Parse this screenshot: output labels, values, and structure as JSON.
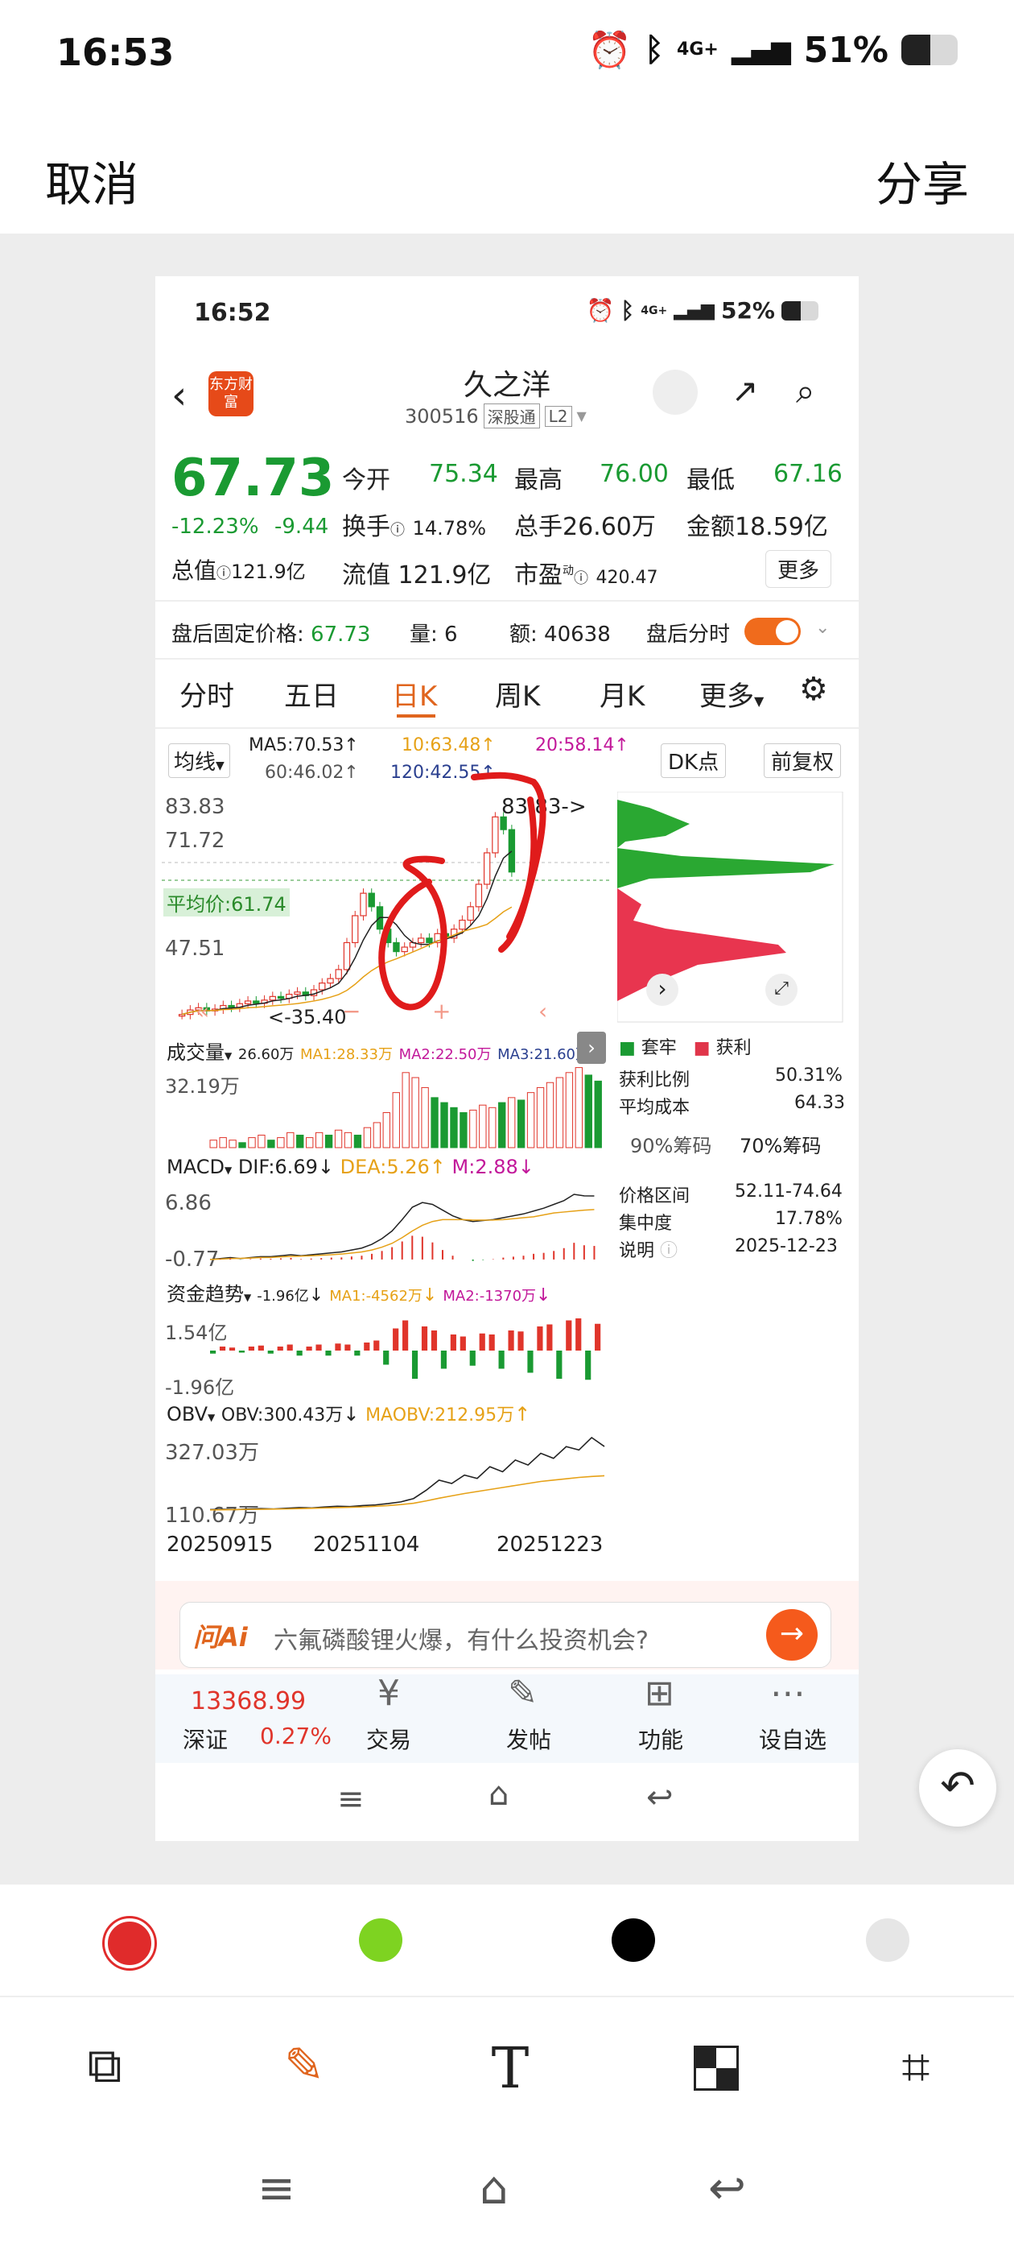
{
  "status_bar": {
    "time": "16:53",
    "network": "4G+",
    "battery_percent": "51%",
    "battery_level": 0.51
  },
  "editor": {
    "cancel_label": "取消",
    "share_label": "分享"
  },
  "colors": {
    "accent": "#e0651e",
    "up": "#e0352b",
    "down": "#1a9a32",
    "palette": [
      "#e02b2b",
      "#7ed321",
      "#000000",
      "#e6e6e6"
    ]
  },
  "inner_status": {
    "time": "16:52",
    "network": "4G+",
    "battery_percent": "52%"
  },
  "stock": {
    "name": "久之洋",
    "code": "300516",
    "badge": "深股通",
    "level": "L2",
    "logo": "东方财富",
    "price": "67.73",
    "change_pct": "-12.23%",
    "change": "-9.44",
    "open_label": "今开",
    "open": "75.34",
    "high_label": "最高",
    "high": "76.00",
    "low_label": "最低",
    "low": "67.16",
    "turnover_label": "换手",
    "turnover": "14.78%",
    "volume_label": "总手",
    "volume": "26.60万",
    "amount_label": "金额",
    "amount": "18.59亿",
    "mcap_label": "总值",
    "mcap": "121.9亿",
    "float_label": "流值",
    "float": "121.9亿",
    "pe_label": "市盈",
    "pe_sup": "动",
    "pe": "420.47",
    "more_label": "更多"
  },
  "afterhours": {
    "price_label": "盘后固定价格:",
    "price": "67.73",
    "qty_label": "量:",
    "qty": "6",
    "amount_label": "额:",
    "amount": "40638",
    "toggle_label": "盘后分时"
  },
  "tabs": [
    "分时",
    "五日",
    "日K",
    "周K",
    "月K",
    "更多"
  ],
  "active_tab": "日K",
  "ma_row": {
    "ma_select": "均线",
    "ma5": "MA5:70.53",
    "ma10": "10:63.48",
    "ma20": "20:58.14",
    "ma60": "60:46.02",
    "ma120": "120:42.55",
    "dk": "DK点",
    "adjust": "前复权"
  },
  "chart_labels": {
    "y1": "83.83",
    "y2": "71.72",
    "y3": "47.51",
    "high_marker": "83.83->",
    "cost_label": "平均价:61.74",
    "low_marker": "<-35.40"
  },
  "volume_panel": {
    "title": "成交量",
    "v": "26.60万",
    "ma1": "MA1:28.33万",
    "ma2": "MA2:22.50万",
    "ma3": "MA3:21.60万",
    "axis": "32.19万"
  },
  "macd_panel": {
    "title": "MACD",
    "dif": "DIF:6.69",
    "dea": "DEA:5.26",
    "m": "M:2.88",
    "axis_top": "6.86",
    "axis_bottom": "-0.77"
  },
  "fund_panel": {
    "title": "资金趋势",
    "v": "-1.96亿",
    "ma1": "MA1:-4562万",
    "ma2": "MA2:-1370万",
    "axis_top": "1.54亿",
    "axis_bottom": "-1.96亿"
  },
  "obv_panel": {
    "title": "OBV",
    "obv": "OBV:300.43万",
    "maobv": "MAOBV:212.95万",
    "axis_top": "327.03万",
    "axis_bottom": "110.67万"
  },
  "dates": [
    "20250915",
    "20251104",
    "20251223"
  ],
  "chip": {
    "legend_trapped": "套牢",
    "legend_profit": "获利",
    "profit_ratio_label": "获利比例",
    "profit_ratio": "50.31%",
    "avg_cost_label": "平均成本",
    "avg_cost": "64.33",
    "chip90": "90%筹码",
    "chip70": "70%筹码",
    "range_label": "价格区间",
    "range": "52.11-74.64",
    "concentration_label": "集中度",
    "concentration": "17.78%",
    "note_label": "说明",
    "date": "2025-12-23"
  },
  "ai_bar": {
    "brand": "问Ai",
    "prompt": "六氟磷酸锂火爆，有什么投资机会?"
  },
  "bottom_nav": {
    "index_value": "13368.99",
    "index_name": "深证",
    "index_change": "0.27%",
    "items": [
      "交易",
      "发帖",
      "功能",
      "设自选"
    ]
  },
  "chart_data": [
    {
      "type": "candlestick",
      "title": "",
      "x": [
        "20250915",
        "20251104",
        "20251223"
      ],
      "ylim": [
        35.4,
        83.83
      ],
      "y_ticks": [
        "83.83",
        "71.72",
        "47.51"
      ],
      "series": [
        {
          "values": [
            36,
            37,
            37.5,
            36.8,
            37.2,
            38,
            37.6,
            38.4,
            39,
            38.5,
            39.2,
            40,
            39.6,
            40.5,
            41,
            40.2,
            41.5,
            43,
            44,
            46,
            52,
            58,
            63,
            60,
            55,
            52,
            50,
            51,
            52,
            53,
            52,
            54,
            53,
            55,
            57,
            60,
            65,
            72,
            80,
            77.17,
            67.73
          ]
        }
      ]
    },
    {
      "type": "bar",
      "title": "成交量",
      "ylim": [
        0,
        32.19
      ],
      "series": [
        {
          "values": [
            3,
            4,
            3,
            2,
            4,
            5,
            3,
            4,
            6,
            5,
            4,
            6,
            5,
            7,
            6,
            5,
            8,
            10,
            14,
            22,
            30,
            28,
            24,
            20,
            18,
            16,
            14,
            15,
            17,
            16,
            18,
            20,
            19,
            22,
            24,
            26,
            28,
            30,
            32,
            29,
            26.6
          ]
        }
      ]
    },
    {
      "type": "line",
      "title": "MACD",
      "ylim": [
        -0.77,
        6.86
      ],
      "series": [
        {
          "name": "DIF",
          "values": [
            0,
            0.1,
            0.2,
            0.1,
            0.2,
            0.3,
            0.3,
            0.4,
            0.5,
            0.4,
            0.5,
            0.6,
            0.7,
            0.8,
            1,
            1.2,
            1.6,
            2.2,
            3,
            4.2,
            5.5,
            6,
            5.8,
            5.2,
            4.6,
            4.2,
            4,
            4.1,
            4.2,
            4.4,
            4.6,
            4.8,
            5.1,
            5.4,
            5.8,
            6.2,
            6.86,
            6.7,
            6.69
          ]
        },
        {
          "name": "DEA",
          "values": [
            0,
            0.05,
            0.1,
            0.12,
            0.15,
            0.2,
            0.22,
            0.28,
            0.33,
            0.35,
            0.4,
            0.45,
            0.5,
            0.58,
            0.68,
            0.8,
            1,
            1.3,
            1.7,
            2.3,
            3,
            3.6,
            4,
            4.2,
            4.2,
            4.2,
            4.15,
            4.15,
            4.16,
            4.2,
            4.3,
            4.4,
            4.5,
            4.7,
            4.9,
            5,
            5.1,
            5.2,
            5.26
          ]
        }
      ]
    },
    {
      "type": "line",
      "title": "OBV",
      "ylim": [
        110.67,
        327.03
      ],
      "series": [
        {
          "name": "OBV",
          "values": [
            112,
            113,
            112,
            114,
            115,
            114,
            116,
            118,
            117,
            120,
            122,
            121,
            124,
            126,
            130,
            135,
            145,
            170,
            200,
            190,
            215,
            205,
            240,
            225,
            260,
            245,
            280,
            265,
            300,
            290,
            327,
            300.43
          ]
        },
        {
          "name": "MAOBV",
          "values": [
            111,
            111.5,
            112,
            112.5,
            113,
            113.5,
            114,
            115,
            116,
            117,
            118,
            119,
            120,
            122,
            124,
            127,
            131,
            138,
            146,
            153,
            160,
            166,
            172,
            178,
            184,
            190,
            196,
            200,
            204,
            208,
            211,
            212.95
          ]
        }
      ]
    }
  ]
}
